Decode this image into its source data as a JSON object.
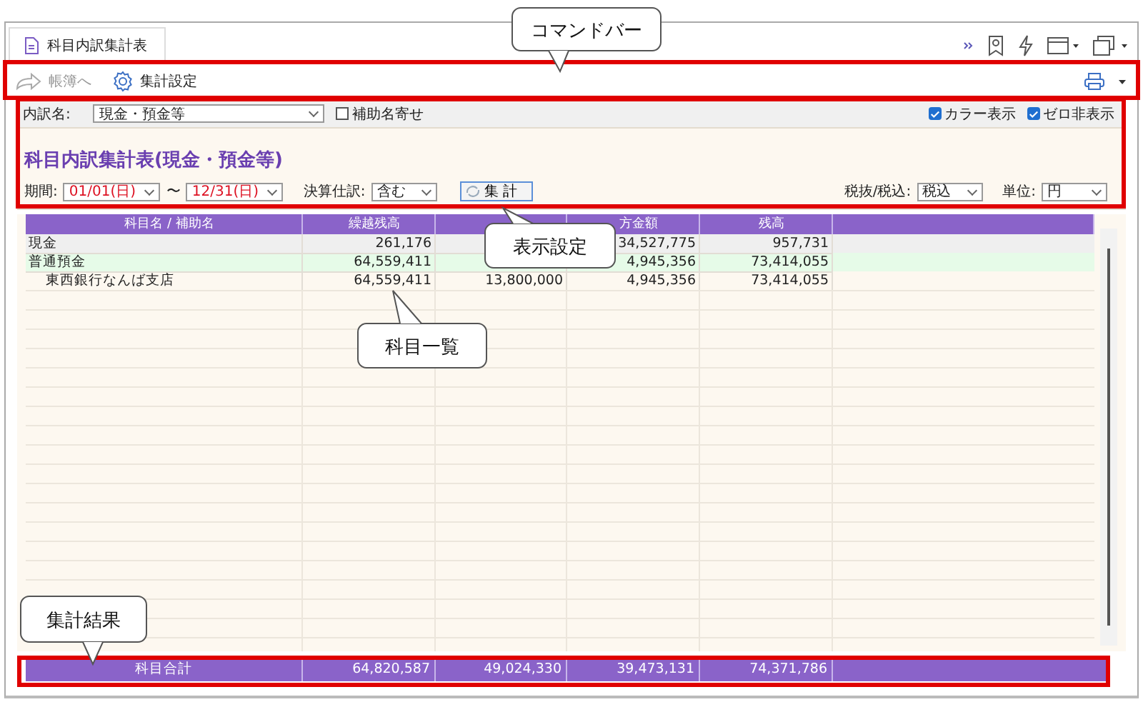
{
  "tab": {
    "label": "科目内訳集計表"
  },
  "command_bar": {
    "items": [
      {
        "kind": "back",
        "label": "帳簿へ",
        "disabled": true
      },
      {
        "kind": "settings",
        "label": "集計設定",
        "disabled": false
      }
    ]
  },
  "filter": {
    "breakdown_label": "内訳名:",
    "breakdown_value": "現金・預金等",
    "subaccount_merge": {
      "label": "補助名寄せ",
      "checked": false
    },
    "color_display": {
      "label": "カラー表示",
      "checked": true
    },
    "zero_hide": {
      "label": "ゼロ非表示",
      "checked": true
    }
  },
  "report": {
    "title": "科目内訳集計表(現金・預金等)",
    "period_label": "期間:",
    "period_from": "01/01(日)",
    "tilde": "〜",
    "period_to": "12/31(日)",
    "closing_label": "決算仕訳:",
    "closing_value": "含む",
    "aggregate_button": "集 計",
    "tax_label": "税抜/税込:",
    "tax_value": "税込",
    "unit_label": "単位:",
    "unit_value": "円"
  },
  "table": {
    "columns": [
      {
        "label": "科目名 / 補助名"
      },
      {
        "label": "繰越残高"
      },
      {},
      {
        "label": "方金額"
      },
      {
        "label": "残高"
      }
    ],
    "rows": [
      {
        "name": "現金",
        "carried": "261,176",
        "credit": "34,527,775",
        "balance": "957,731"
      },
      {
        "name": "普通預金",
        "carried": "64,559,411",
        "credit": "4,945,356",
        "balance": "73,414,055",
        "children": [
          {
            "name": "東西銀行なんば支店",
            "carried": "64,559,411",
            "debit": "13,800,000",
            "credit": "4,945,356",
            "balance": "73,414,055"
          }
        ]
      }
    ],
    "total": {
      "name": "科目合計",
      "carried": "64,820,587",
      "debit": "49,024,330",
      "credit": "39,473,131",
      "balance": "74,371,786"
    }
  },
  "callouts": [
    {
      "text": "コマンドバー"
    },
    {
      "text": "表示設定"
    },
    {
      "text": "科目一覧"
    },
    {
      "text": "集計結果"
    }
  ]
}
